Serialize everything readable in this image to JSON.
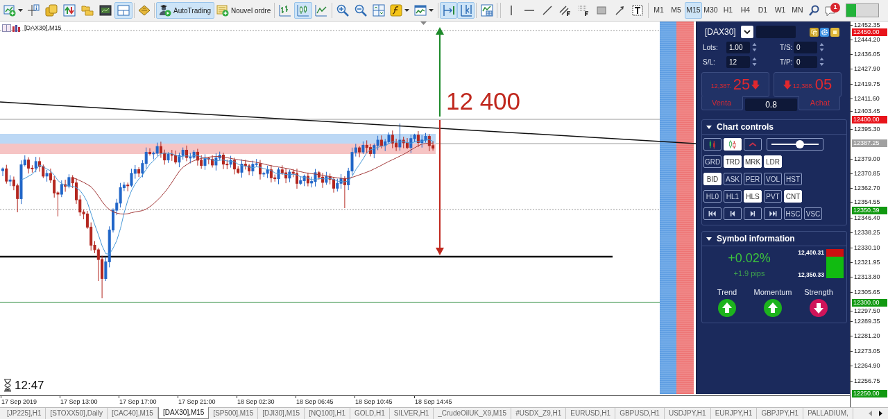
{
  "toolbar": {
    "window_buttons": [
      {
        "pressed": false
      },
      {
        "pressed": false
      },
      {
        "pressed": false
      },
      {
        "pressed": false
      },
      {
        "pressed": false
      },
      {
        "pressed": true
      }
    ],
    "autotrading": {
      "label": "AutoTrading",
      "pressed": true
    },
    "new_order": {
      "label": "Nouvel ordre"
    },
    "chart_types": [
      {
        "selected": false
      },
      {
        "selected": true
      },
      {
        "selected": false
      }
    ],
    "chart_toggles": [
      {
        "pressed": true
      },
      {
        "pressed": true
      },
      {
        "pressed": false
      }
    ],
    "timeframes": [
      {
        "label": "M1",
        "selected": false
      },
      {
        "label": "M5",
        "selected": false
      },
      {
        "label": "M15",
        "selected": true
      },
      {
        "label": "M30",
        "selected": false
      },
      {
        "label": "H1",
        "selected": false
      },
      {
        "label": "H4",
        "selected": false
      },
      {
        "label": "D1",
        "selected": false
      },
      {
        "label": "W1",
        "selected": false
      },
      {
        "label": "MN",
        "selected": false
      }
    ],
    "notifications": {
      "count": "1"
    }
  },
  "chart": {
    "title": "[DAX30],M15",
    "annotation": "12 400",
    "timer": "12:47",
    "price_axis": [
      {
        "kind": "tick",
        "text": "12452.35"
      },
      {
        "kind": "marker",
        "text": "12450.00",
        "color": "#e8141b"
      },
      {
        "kind": "tick",
        "text": "12444.20"
      },
      {
        "kind": "tick",
        "text": "12436.05"
      },
      {
        "kind": "tick",
        "text": "12427.90"
      },
      {
        "kind": "tick",
        "text": "12419.75"
      },
      {
        "kind": "tick",
        "text": "12411.60"
      },
      {
        "kind": "tick",
        "text": "12403.45"
      },
      {
        "kind": "marker",
        "text": "12400.00",
        "color": "#e8141b"
      },
      {
        "kind": "tick",
        "text": "12395.30"
      },
      {
        "kind": "marker",
        "text": "12387.25",
        "color": "#a0a0a0"
      },
      {
        "kind": "tick",
        "text": "12379.00"
      },
      {
        "kind": "tick",
        "text": "12370.85"
      },
      {
        "kind": "tick",
        "text": "12362.70"
      },
      {
        "kind": "tick",
        "text": "12354.55"
      },
      {
        "kind": "marker",
        "text": "12350.39",
        "color": "#119911"
      },
      {
        "kind": "tick",
        "text": "12346.40"
      },
      {
        "kind": "tick",
        "text": "12338.25"
      },
      {
        "kind": "tick",
        "text": "12330.10"
      },
      {
        "kind": "tick",
        "text": "12321.95"
      },
      {
        "kind": "tick",
        "text": "12313.80"
      },
      {
        "kind": "tick",
        "text": "12305.65"
      },
      {
        "kind": "marker",
        "text": "12300.00",
        "color": "#119911"
      },
      {
        "kind": "tick",
        "text": "12297.50"
      },
      {
        "kind": "tick",
        "text": "12289.35"
      },
      {
        "kind": "tick",
        "text": "12281.20"
      },
      {
        "kind": "tick",
        "text": "12273.05"
      },
      {
        "kind": "tick",
        "text": "12264.90"
      },
      {
        "kind": "tick",
        "text": "12256.75"
      },
      {
        "kind": "marker",
        "text": "12250.00",
        "color": "#119911"
      }
    ],
    "time_axis": [
      "17 Sep 2019",
      "17 Sep 13:00",
      "17 Sep 17:00",
      "17 Sep 21:00",
      "18 Sep 02:30",
      "18 Sep 06:45",
      "18 Sep 10:45",
      "18 Sep 14:45"
    ]
  },
  "trade_panel": {
    "symbol": "[DAX30]",
    "fields": [
      {
        "label": "Lots:",
        "value": "1.00"
      },
      {
        "label": "T/S:",
        "value": "0"
      },
      {
        "label": "S/L:",
        "value": "12"
      },
      {
        "label": "T/P:",
        "value": "0"
      }
    ],
    "sell": {
      "price": "12,387.",
      "pips": "25",
      "label": "Venta"
    },
    "buy": {
      "price": "12,388.",
      "pips": "05",
      "label": "Achat"
    },
    "spread": "0.8"
  },
  "chart_controls": {
    "title": "Chart controls",
    "expanded": true,
    "icon_buttons": [
      {
        "on": false
      },
      {
        "on": true
      },
      {
        "on": false
      }
    ],
    "slider": {
      "level": 0.6
    },
    "button_rows": [
      [
        {
          "label": "GRD",
          "on": false
        },
        {
          "label": "TRD",
          "on": true
        },
        {
          "label": "MRK",
          "on": true
        },
        {
          "label": "LDR",
          "on": true
        }
      ],
      [
        {
          "label": "BID",
          "on": true
        },
        {
          "label": "ASK",
          "on": false
        },
        {
          "label": "PER",
          "on": false
        },
        {
          "label": "VOL",
          "on": false
        },
        {
          "label": "HST",
          "on": false
        }
      ],
      [
        {
          "label": "HL0",
          "on": false
        },
        {
          "label": "HL1",
          "on": false
        },
        {
          "label": "HLS",
          "on": true
        },
        {
          "label": "PVT",
          "on": false
        },
        {
          "label": "CNT",
          "on": true
        }
      ]
    ],
    "nav_buttons": [
      {
        "on": false
      },
      {
        "on": false
      },
      {
        "on": false
      },
      {
        "on": false
      }
    ],
    "scale_buttons": [
      {
        "label": "HSC",
        "on": false
      },
      {
        "label": "VSC",
        "on": false
      }
    ]
  },
  "symbol_info": {
    "title": "Symbol information",
    "expanded": true,
    "change": "+0.02%",
    "pips": "+1.9 pips",
    "high": "12,400.31",
    "low": "12,350.33",
    "range": {
      "level": 0.74
    },
    "indicators": [
      {
        "label": "Trend",
        "rising": true
      },
      {
        "label": "Momentum",
        "rising": true
      },
      {
        "label": "Strength",
        "rising": false
      }
    ]
  },
  "tabs": [
    {
      "label": "[JP225],H1",
      "selected": false
    },
    {
      "label": "[STOXX50],Daily",
      "selected": false
    },
    {
      "label": "[CAC40],M15",
      "selected": false
    },
    {
      "label": "[DAX30],M15",
      "selected": true
    },
    {
      "label": "[SP500],M15",
      "selected": false
    },
    {
      "label": "[DJI30],M15",
      "selected": false
    },
    {
      "label": "[NQ100],H1",
      "selected": false
    },
    {
      "label": "GOLD,H1",
      "selected": false
    },
    {
      "label": "SILVER,H1",
      "selected": false
    },
    {
      "label": "_CrudeOilUK_X9,M15",
      "selected": false
    },
    {
      "label": "#USDX_Z9,H1",
      "selected": false
    },
    {
      "label": "EURUSD,H1",
      "selected": false
    },
    {
      "label": "GBPUSD,H1",
      "selected": false
    },
    {
      "label": "USDJPY,H1",
      "selected": false
    },
    {
      "label": "EURJPY,H1",
      "selected": false
    },
    {
      "label": "GBPJPY,H1",
      "selected": false
    },
    {
      "label": "PALLADIUM,",
      "selected": false
    }
  ]
}
